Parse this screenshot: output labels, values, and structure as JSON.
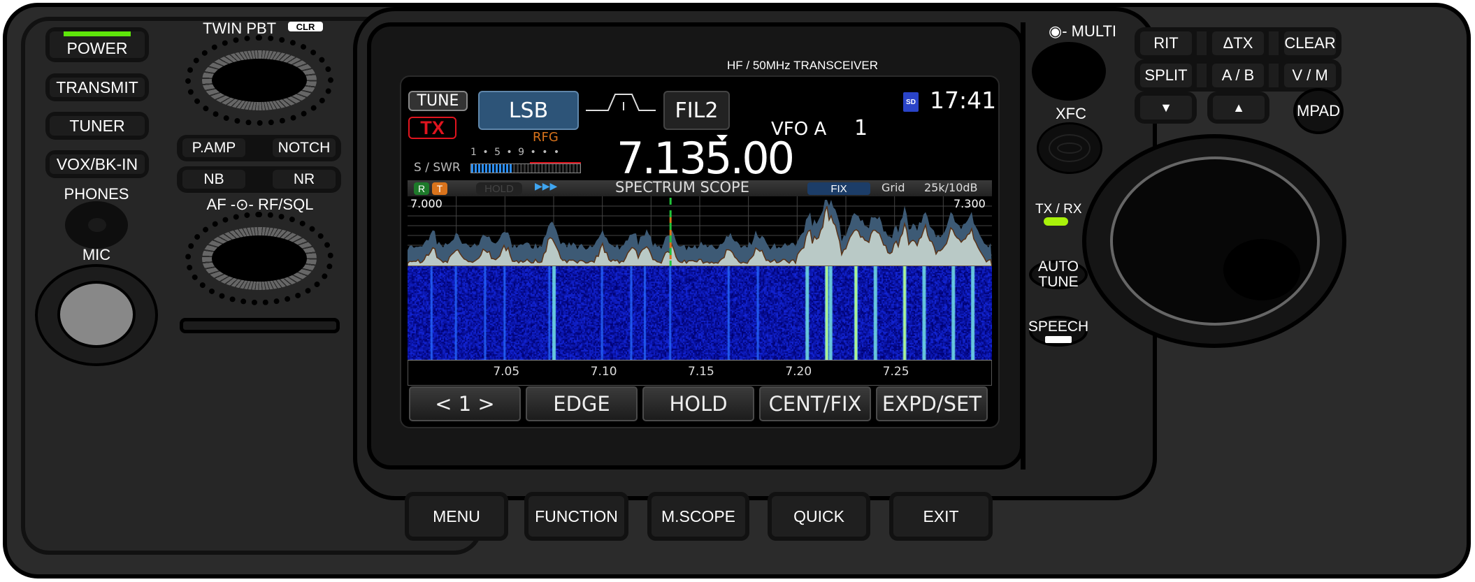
{
  "left": {
    "power": "POWER",
    "transmit": "TRANSMIT",
    "tuner": "TUNER",
    "vox": "VOX/BK-IN",
    "phones": "PHONES",
    "mic": "MIC",
    "twin_pbt": "TWIN PBT",
    "clr": "CLR",
    "pamp": "P.AMP",
    "notch": "NOTCH",
    "nb": "NB",
    "nr": "NR",
    "af_rf": "AF -⊙- RF/SQL"
  },
  "header": "HF / 50MHz TRANSCEIVER",
  "screen": {
    "tune": "TUNE",
    "tx": "TX",
    "mode": "LSB",
    "filter": "FIL2",
    "rfg": "RFG",
    "sd": "SD",
    "clock": "17:41",
    "vfo": "VFO A",
    "vfo_num": "1",
    "frequency": "7.135.00",
    "meter_label": "S / SWR",
    "meter_scale": "1 • 5 • 9  •  •  •",
    "scope": {
      "r": "R",
      "t": "T",
      "hold_badge": "HOLD",
      "arrows": "▶▶▶",
      "title": "SPECTRUM SCOPE",
      "fix": "FIX",
      "grid": "Grid",
      "span": "25k/10dB",
      "start": "7.000",
      "end": "7.300",
      "range": [
        7.0,
        7.3
      ],
      "marker": 7.135,
      "ticks": [
        "7.05",
        "7.10",
        "7.15",
        "7.20",
        "7.25"
      ],
      "signals": [
        7.0125,
        7.025,
        7.04,
        7.05,
        7.073,
        7.075,
        7.1,
        7.115,
        7.122,
        7.135,
        7.165,
        7.18,
        7.205,
        7.215,
        7.217,
        7.23,
        7.24,
        7.255,
        7.265,
        7.28,
        7.29
      ]
    },
    "softkeys": [
      "< 1 >",
      "EDGE",
      "HOLD",
      "CENT/FIX",
      "EXPD/SET"
    ]
  },
  "bottom": [
    "MENU",
    "FUNCTION",
    "M.SCOPE",
    "QUICK",
    "EXIT"
  ],
  "side": {
    "multi": "MULTI",
    "xfc": "XFC",
    "txrx": "TX / RX",
    "auto": "AUTO",
    "tune": "TUNE",
    "speech": "SPEECH"
  },
  "right": {
    "rit": "RIT",
    "dtx": "ΔTX",
    "clear": "CLEAR",
    "split": "SPLIT",
    "ab": "A / B",
    "vm": "V / M",
    "down": "▼",
    "up": "▲",
    "mpad": "MPAD"
  },
  "colors": {
    "led": "#5ee60a",
    "mode": "#2d5478",
    "tx": "#e0141e",
    "rfg": "#d9731c"
  }
}
